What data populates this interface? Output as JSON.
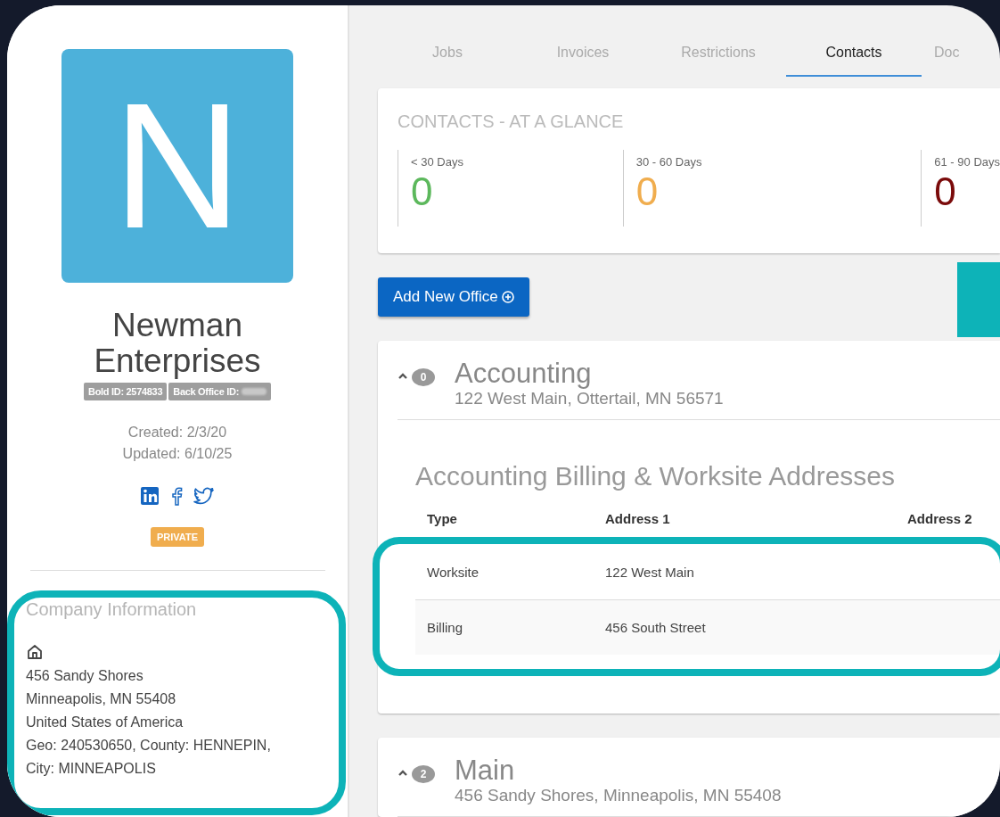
{
  "profile": {
    "initial": "N",
    "name": "Newman Enterprises",
    "ids": [
      {
        "label": "Bold ID: 2574833",
        "redacted": false
      },
      {
        "label": "Back Office ID:",
        "redacted": true
      }
    ],
    "created": "Created: 2/3/20",
    "updated": "Updated: 6/10/25",
    "badge": "PRIVATE"
  },
  "company_info": {
    "title": "Company Information",
    "highlighted": true,
    "lines": [
      "456 Sandy Shores",
      "Minneapolis, MN 55408",
      "United States of America",
      "Geo: 240530650, County: HENNEPIN,",
      "City: MINNEAPOLIS"
    ]
  },
  "tabs": [
    {
      "label": "Jobs",
      "selected": false
    },
    {
      "label": "Invoices",
      "selected": false
    },
    {
      "label": "Restrictions",
      "selected": false
    },
    {
      "label": "Contacts",
      "selected": true
    },
    {
      "label": "Doc",
      "selected": false
    }
  ],
  "glance": {
    "title": "CONTACTS - AT A GLANCE",
    "stats": [
      {
        "label": "< 30 Days",
        "value": "0",
        "color": "#5cb85c"
      },
      {
        "label": "30 - 60 Days",
        "value": "0",
        "color": "#f0ad4e"
      },
      {
        "label": "61 - 90 Days",
        "value": "0",
        "color": "#7a0a0a"
      }
    ]
  },
  "add_button": "Add New Office",
  "offices": [
    {
      "name": "Accounting",
      "count": "0",
      "address": "122 West Main, Ottertail, MN 56571",
      "expanded": true,
      "addresses": {
        "title": "Accounting Billing & Worksite Addresses",
        "highlighted": true,
        "columns": [
          "Type",
          "Address 1",
          "Address 2"
        ],
        "rows": [
          {
            "type": "Worksite",
            "address_1": "122 West Main"
          },
          {
            "type": "Billing",
            "address_1": "456 South Street"
          }
        ]
      }
    },
    {
      "name": "Main",
      "count": "2",
      "address": "456 Sandy Shores, Minneapolis, MN 55408",
      "expanded": true
    }
  ]
}
